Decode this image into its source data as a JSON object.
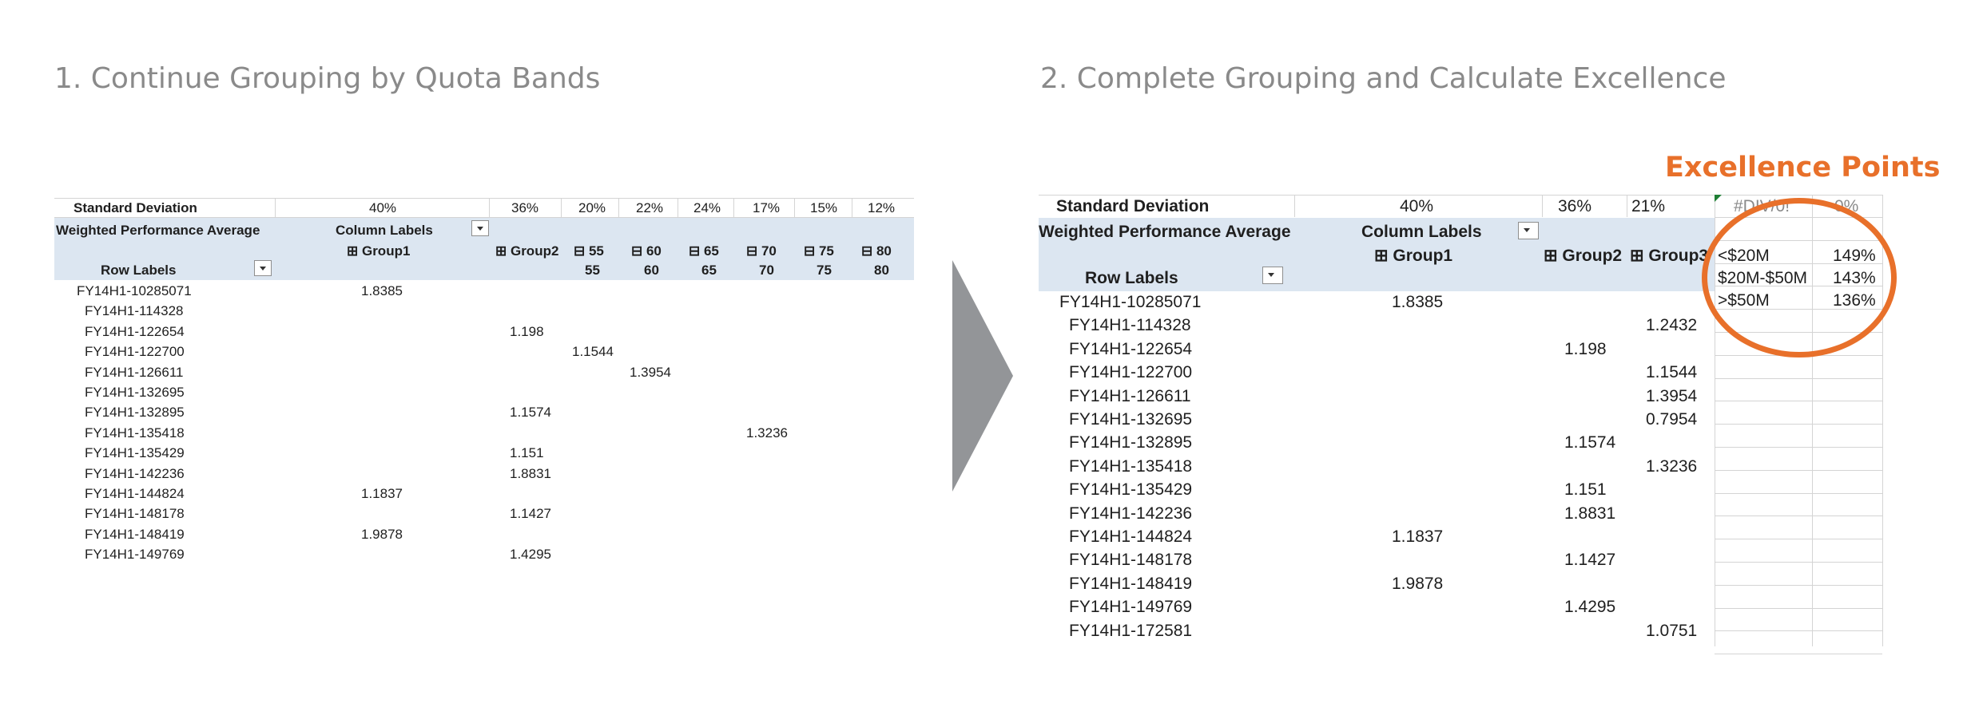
{
  "left_title": "1. Continue Grouping by Quota Bands",
  "right_title": "2. Complete Grouping and Calculate Excellence",
  "left_table": {
    "std_dev_label": "Standard Deviation",
    "std_dev_values": [
      "40%",
      "36%",
      "20%",
      "22%",
      "24%",
      "17%",
      "15%",
      "12%"
    ],
    "wpa_label": "Weighted Performance Average",
    "column_labels": "Column Labels",
    "group1": "⊞ Group1",
    "group2": "⊞ Group2",
    "bands_top": [
      "⊟ 55",
      "⊟ 60",
      "⊟ 65",
      "⊟ 70",
      "⊟ 75",
      "⊟ 80"
    ],
    "bands_bottom": [
      "55",
      "60",
      "65",
      "70",
      "75",
      "80"
    ],
    "row_labels": "Row Labels",
    "rows": [
      {
        "label": "FY14H1-10285071",
        "group1": "1.8385"
      },
      {
        "label": "FY14H1-114328"
      },
      {
        "label": "FY14H1-122654",
        "group2": "1.198"
      },
      {
        "label": "FY14H1-122700",
        "b55": "1.1544"
      },
      {
        "label": "FY14H1-126611",
        "b60": "1.3954"
      },
      {
        "label": "FY14H1-132695"
      },
      {
        "label": "FY14H1-132895",
        "group2": "1.1574"
      },
      {
        "label": "FY14H1-135418",
        "b70": "1.3236"
      },
      {
        "label": "FY14H1-135429",
        "group2": "1.151"
      },
      {
        "label": "FY14H1-142236",
        "group2": "1.8831"
      },
      {
        "label": "FY14H1-144824",
        "group1": "1.1837"
      },
      {
        "label": "FY14H1-148178",
        "group2": "1.1427"
      },
      {
        "label": "FY14H1-148419",
        "group1": "1.9878"
      },
      {
        "label": "FY14H1-149769",
        "group2": "1.4295"
      }
    ]
  },
  "right_table": {
    "std_dev_label": "Standard Deviation",
    "std_dev_values": [
      "40%",
      "36%",
      "21%"
    ],
    "std_dev_extra": [
      "#DIV/0!",
      "0%"
    ],
    "wpa_label": "Weighted Performance Average",
    "column_labels": "Column Labels",
    "group1": "⊞ Group1",
    "group2": "⊞ Group2",
    "group3": "⊞ Group3",
    "row_labels": "Row Labels",
    "rows": [
      {
        "label": "FY14H1-10285071",
        "group1": "1.8385"
      },
      {
        "label": "FY14H1-114328",
        "group3": "1.2432"
      },
      {
        "label": "FY14H1-122654",
        "group2": "1.198"
      },
      {
        "label": "FY14H1-122700",
        "group3": "1.1544"
      },
      {
        "label": "FY14H1-126611",
        "group3": "1.3954"
      },
      {
        "label": "FY14H1-132695",
        "group3": "0.7954"
      },
      {
        "label": "FY14H1-132895",
        "group2": "1.1574"
      },
      {
        "label": "FY14H1-135418",
        "group3": "1.3236"
      },
      {
        "label": "FY14H1-135429",
        "group2": "1.151"
      },
      {
        "label": "FY14H1-142236",
        "group2": "1.8831"
      },
      {
        "label": "FY14H1-144824",
        "group1": "1.1837"
      },
      {
        "label": "FY14H1-148178",
        "group2": "1.1427"
      },
      {
        "label": "FY14H1-148419",
        "group1": "1.9878"
      },
      {
        "label": "FY14H1-149769",
        "group2": "1.4295"
      },
      {
        "label": "FY14H1-172581",
        "group3": "1.0751"
      }
    ]
  },
  "excellence": {
    "title": "Excellence Points",
    "bands": [
      {
        "band": "<$20M",
        "value": "149%"
      },
      {
        "band": "$20M-$50M",
        "value": "143%"
      },
      {
        "band": ">$50M",
        "value": "136%"
      }
    ]
  },
  "colors": {
    "accent": "#e8702a",
    "header_band": "#dce6f1",
    "title_gray": "#8a8a8a",
    "arrow_gray": "#939598"
  }
}
